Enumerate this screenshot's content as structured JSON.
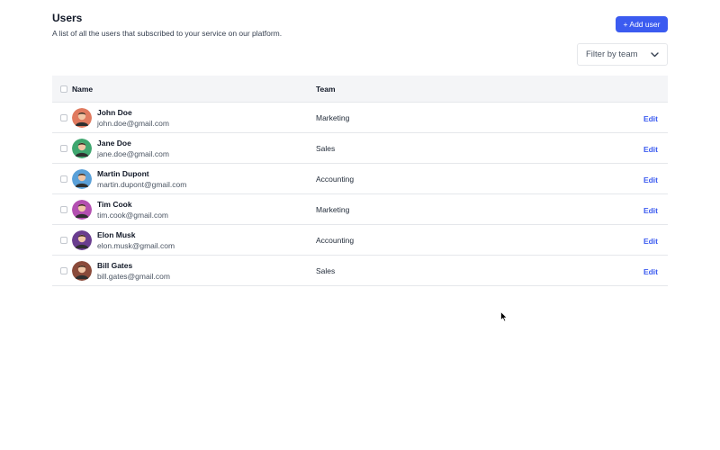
{
  "page": {
    "title": "Users",
    "subtitle": "A list of all the users that subscribed to your service on our platform."
  },
  "actions": {
    "add_user_label": "+ Add user",
    "filter_label": "Filter by team"
  },
  "table": {
    "headers": {
      "name": "Name",
      "team": "Team"
    },
    "rows": [
      {
        "name": "John Doe",
        "email": "john.doe@gmail.com",
        "team": "Marketing",
        "action": "Edit"
      },
      {
        "name": "Jane Doe",
        "email": "jane.doe@gmail.com",
        "team": "Sales",
        "action": "Edit"
      },
      {
        "name": "Martin Dupont",
        "email": "martin.dupont@gmail.com",
        "team": "Accounting",
        "action": "Edit"
      },
      {
        "name": "Tim Cook",
        "email": "tim.cook@gmail.com",
        "team": "Marketing",
        "action": "Edit"
      },
      {
        "name": "Elon Musk",
        "email": "elon.musk@gmail.com",
        "team": "Accounting",
        "action": "Edit"
      },
      {
        "name": "Bill Gates",
        "email": "bill.gates@gmail.com",
        "team": "Sales",
        "action": "Edit"
      }
    ]
  },
  "colors": {
    "accent": "#3b5bf0",
    "header_bg": "#f4f5f7",
    "avatars": [
      "#e07a5f",
      "#3fa66f",
      "#5aa0d8",
      "#b34fb0",
      "#6a3d8f",
      "#8a4a3a"
    ]
  }
}
